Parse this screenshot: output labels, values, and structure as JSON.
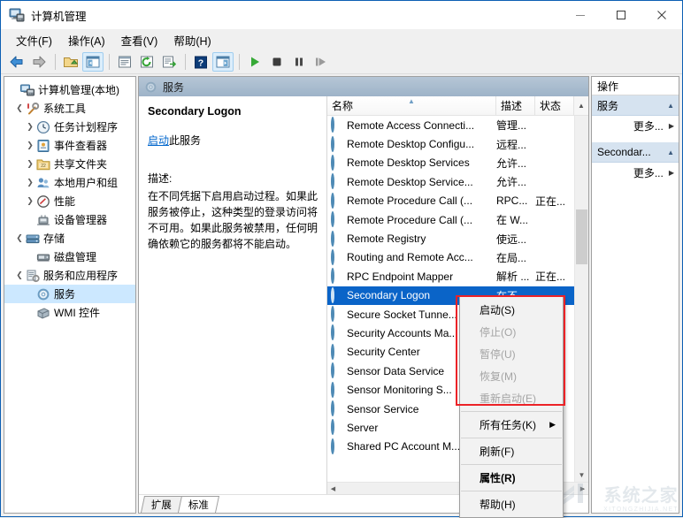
{
  "window": {
    "title": "计算机管理",
    "icon": "computer-management-icon",
    "minimize_label": "最小化",
    "maximize_label": "最大化",
    "close_label": "关闭"
  },
  "menubar": {
    "items": [
      {
        "label": "文件(F)"
      },
      {
        "label": "操作(A)"
      },
      {
        "label": "查看(V)"
      },
      {
        "label": "帮助(H)"
      }
    ]
  },
  "toolbar": {
    "items": [
      {
        "name": "back-icon",
        "glyph": "back"
      },
      {
        "name": "forward-icon",
        "glyph": "forward"
      },
      {
        "name": "up-folder-icon",
        "glyph": "folder"
      },
      {
        "name": "show-hide-tree-icon",
        "glyph": "panel-left",
        "active": true
      },
      {
        "name": "properties-icon",
        "glyph": "properties"
      },
      {
        "name": "refresh-icon",
        "glyph": "refresh"
      },
      {
        "name": "export-list-icon",
        "glyph": "export"
      },
      {
        "name": "help-icon",
        "glyph": "help"
      },
      {
        "name": "show-action-pane-icon",
        "glyph": "panel-right",
        "active": true
      },
      {
        "name": "start-service-icon",
        "glyph": "play"
      },
      {
        "name": "stop-service-icon",
        "glyph": "stop"
      },
      {
        "name": "pause-service-icon",
        "glyph": "pause"
      },
      {
        "name": "restart-service-icon",
        "glyph": "restart"
      }
    ]
  },
  "tree": {
    "nodes": [
      {
        "label": "计算机管理(本地)",
        "depth": 0,
        "twist": "",
        "icon": "computer-icon"
      },
      {
        "label": "系统工具",
        "depth": 1,
        "twist": "expanded",
        "icon": "tools-icon"
      },
      {
        "label": "任务计划程序",
        "depth": 2,
        "twist": "collapsed",
        "icon": "clock-icon"
      },
      {
        "label": "事件查看器",
        "depth": 2,
        "twist": "collapsed",
        "icon": "event-log-icon"
      },
      {
        "label": "共享文件夹",
        "depth": 2,
        "twist": "collapsed",
        "icon": "shared-folder-icon"
      },
      {
        "label": "本地用户和组",
        "depth": 2,
        "twist": "collapsed",
        "icon": "users-icon"
      },
      {
        "label": "性能",
        "depth": 2,
        "twist": "collapsed",
        "icon": "performance-icon"
      },
      {
        "label": "设备管理器",
        "depth": 2,
        "twist": "",
        "icon": "device-manager-icon"
      },
      {
        "label": "存储",
        "depth": 1,
        "twist": "expanded",
        "icon": "storage-icon"
      },
      {
        "label": "磁盘管理",
        "depth": 2,
        "twist": "",
        "icon": "disk-icon"
      },
      {
        "label": "服务和应用程序",
        "depth": 1,
        "twist": "expanded",
        "icon": "services-apps-icon"
      },
      {
        "label": "服务",
        "depth": 2,
        "twist": "",
        "icon": "service-gear-icon",
        "selected": true
      },
      {
        "label": "WMI 控件",
        "depth": 2,
        "twist": "",
        "icon": "wmi-icon"
      }
    ]
  },
  "center": {
    "header": "服务",
    "header_icon": "service-gear-icon",
    "detail": {
      "service_name": "Secondary Logon",
      "action_link": "启动",
      "action_suffix": "此服务",
      "description_label": "描述:",
      "description": "在不同凭据下启用启动过程。如果此服务被停止，这种类型的登录访问将不可用。如果此服务被禁用，任何明确依赖它的服务都将不能启动。"
    },
    "list": {
      "columns": [
        {
          "key": "name",
          "label": "名称",
          "sorted": "asc"
        },
        {
          "key": "desc",
          "label": "描述"
        },
        {
          "key": "state",
          "label": "状态"
        }
      ],
      "rows": [
        {
          "name": "Remote Access Connecti...",
          "desc": "管理...",
          "state": ""
        },
        {
          "name": "Remote Desktop Configu...",
          "desc": "远程...",
          "state": ""
        },
        {
          "name": "Remote Desktop Services",
          "desc": "允许...",
          "state": ""
        },
        {
          "name": "Remote Desktop Service...",
          "desc": "允许...",
          "state": ""
        },
        {
          "name": "Remote Procedure Call (...",
          "desc": "RPC...",
          "state": "正在..."
        },
        {
          "name": "Remote Procedure Call (...",
          "desc": "在 W...",
          "state": ""
        },
        {
          "name": "Remote Registry",
          "desc": "使远...",
          "state": ""
        },
        {
          "name": "Routing and Remote Acc...",
          "desc": "在局...",
          "state": ""
        },
        {
          "name": "RPC Endpoint Mapper",
          "desc": "解析 ...",
          "state": "正在..."
        },
        {
          "name": "Secondary Logon",
          "desc": "在不...",
          "state": "",
          "selected": true
        },
        {
          "name": "Secure Socket Tunne...",
          "desc": "",
          "state": ""
        },
        {
          "name": "Security Accounts Ma...",
          "desc": "",
          "state": ""
        },
        {
          "name": "Security Center",
          "desc": "",
          "state": ""
        },
        {
          "name": "Sensor Data Service",
          "desc": "",
          "state": ""
        },
        {
          "name": "Sensor Monitoring S...",
          "desc": "",
          "state": ""
        },
        {
          "name": "Sensor Service",
          "desc": "",
          "state": ""
        },
        {
          "name": "Server",
          "desc": "",
          "state": ""
        },
        {
          "name": "Shared PC Account M...",
          "desc": "",
          "state": ""
        }
      ]
    },
    "tabs": [
      {
        "label": "扩展",
        "active": false
      },
      {
        "label": "标准",
        "active": true
      }
    ]
  },
  "actions": {
    "header": "操作",
    "groups": [
      {
        "title": "服务",
        "items": [
          {
            "label": "更多...",
            "has_submenu": true
          }
        ]
      },
      {
        "title": "Secondar...",
        "items": [
          {
            "label": "更多...",
            "has_submenu": true
          }
        ]
      }
    ]
  },
  "context_menu": {
    "items": [
      {
        "label": "启动(S)",
        "disabled": false,
        "bold": false,
        "submenu": false
      },
      {
        "label": "停止(O)",
        "disabled": true,
        "bold": false,
        "submenu": false
      },
      {
        "label": "暂停(U)",
        "disabled": true,
        "bold": false,
        "submenu": false
      },
      {
        "label": "恢复(M)",
        "disabled": true,
        "bold": false,
        "submenu": false
      },
      {
        "label": "重新启动(E)",
        "disabled": true,
        "bold": false,
        "submenu": false
      },
      {
        "separator": true
      },
      {
        "label": "所有任务(K)",
        "disabled": false,
        "bold": false,
        "submenu": true
      },
      {
        "separator": true
      },
      {
        "label": "刷新(F)",
        "disabled": false,
        "bold": false,
        "submenu": false
      },
      {
        "separator": true
      },
      {
        "label": "属性(R)",
        "disabled": false,
        "bold": true,
        "submenu": false
      },
      {
        "separator": true
      },
      {
        "label": "帮助(H)",
        "disabled": false,
        "bold": false,
        "submenu": false
      }
    ]
  },
  "watermark": {
    "main": "系统之家",
    "sub": "XITONGZHIJIA.NET"
  },
  "colors": {
    "accent": "#0c5fb3",
    "selection": "#0a64c8",
    "highlight_box": "#ec2227",
    "center_header": "#a8bcd0",
    "action_group": "#d6e3f0"
  }
}
